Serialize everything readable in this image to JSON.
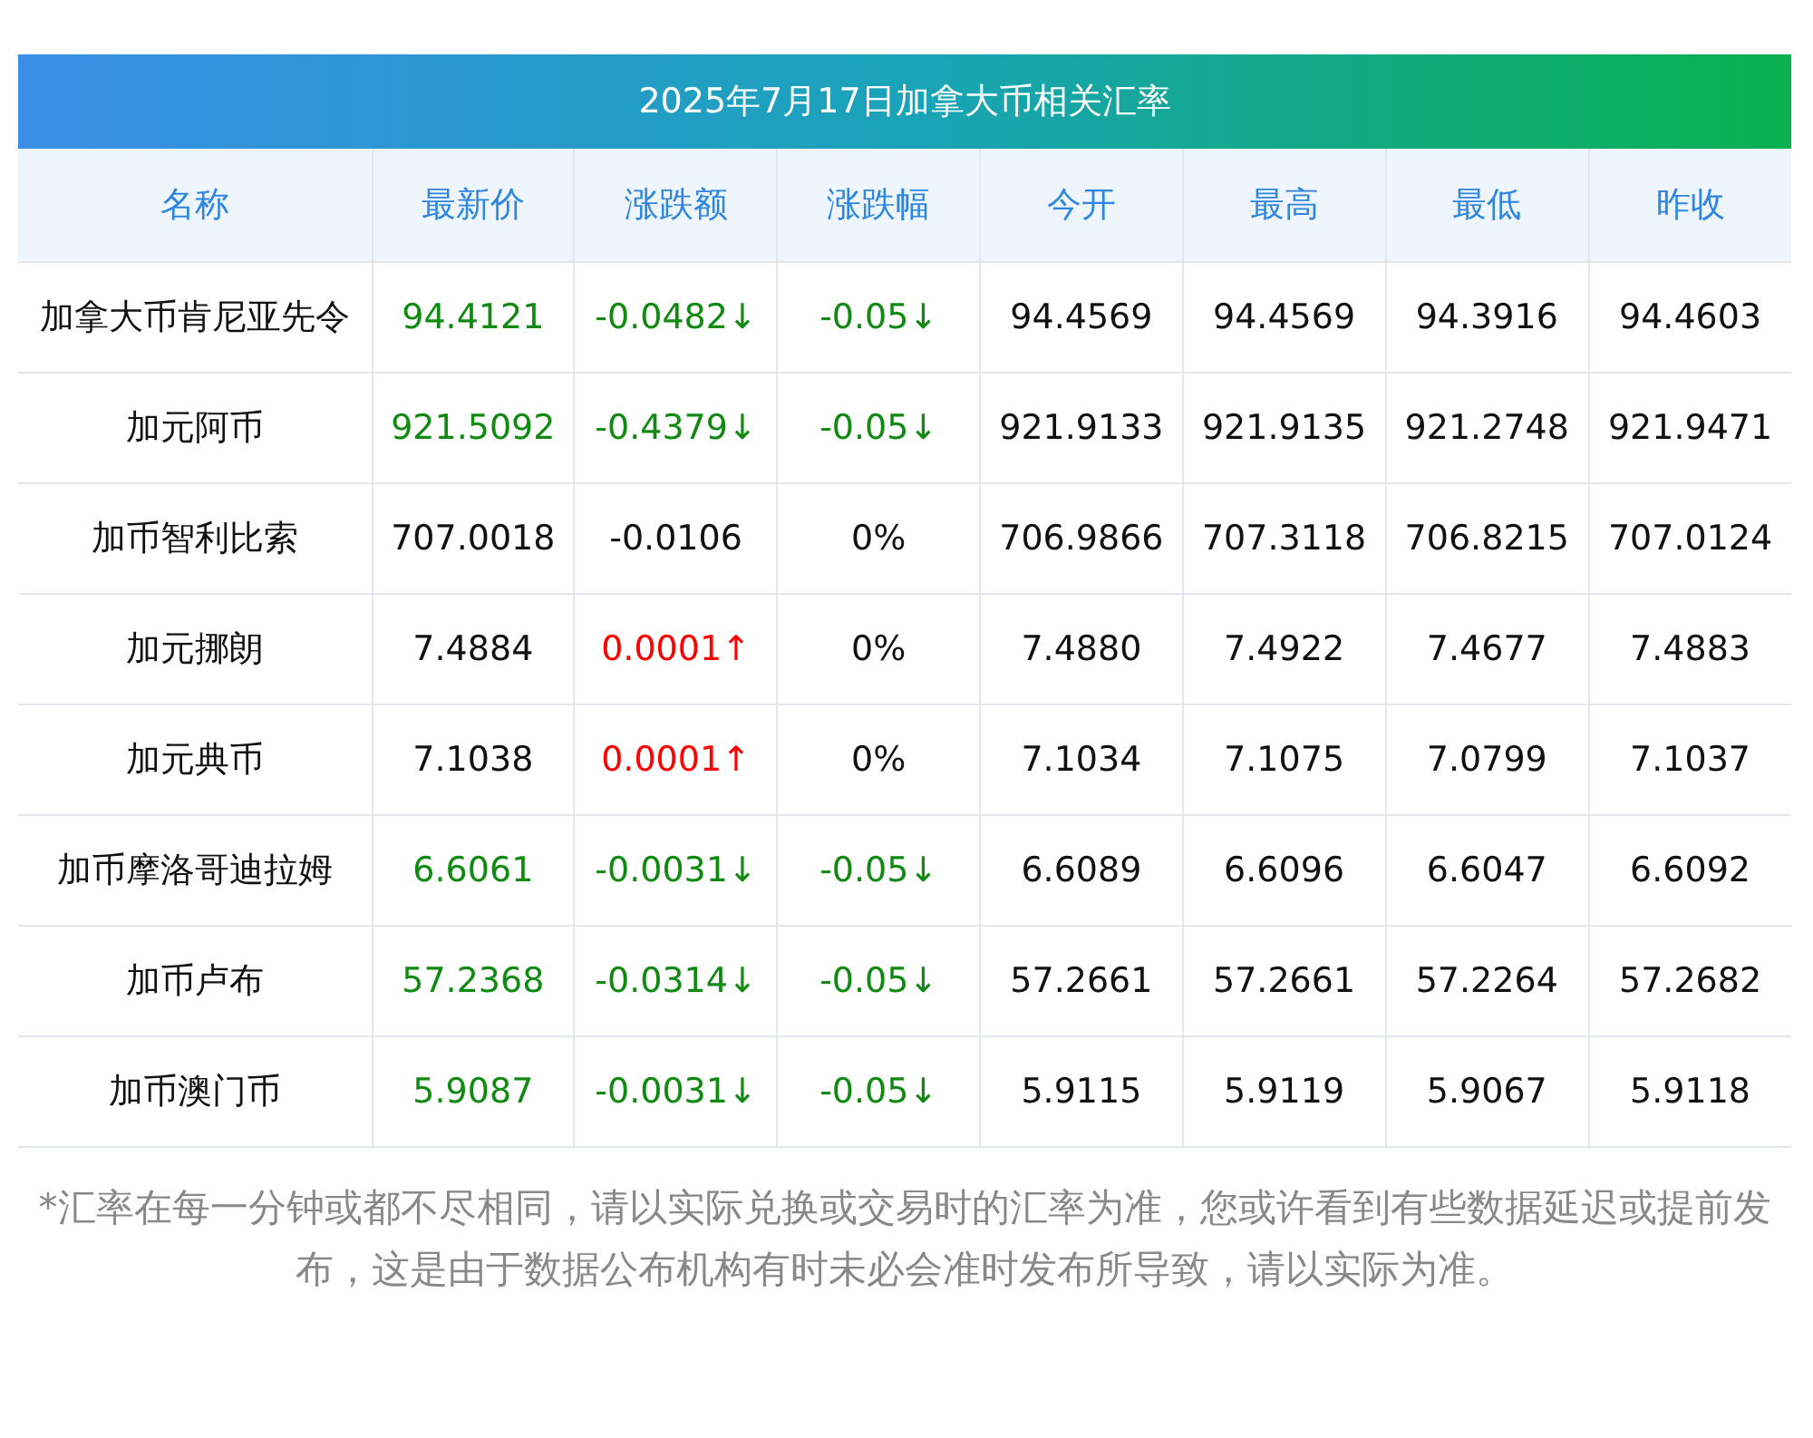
{
  "title": "2025年7月17日加拿大币相关汇率",
  "columns": [
    "名称",
    "最新价",
    "涨跌额",
    "涨跌幅",
    "今开",
    "最高",
    "最低",
    "昨收"
  ],
  "rows": [
    {
      "name": "加拿大币肯尼亚先令",
      "price": {
        "text": "94.4121",
        "color": "#118a11"
      },
      "change": {
        "text": "-0.0482↓",
        "color": "#118a11"
      },
      "pct": {
        "text": "-0.05↓",
        "color": "#118a11"
      },
      "open": "94.4569",
      "high": "94.4569",
      "low": "94.3916",
      "prev": "94.4603"
    },
    {
      "name": "加元阿币",
      "price": {
        "text": "921.5092",
        "color": "#118a11"
      },
      "change": {
        "text": "-0.4379↓",
        "color": "#118a11"
      },
      "pct": {
        "text": "-0.05↓",
        "color": "#118a11"
      },
      "open": "921.9133",
      "high": "921.9135",
      "low": "921.2748",
      "prev": "921.9471"
    },
    {
      "name": "加币智利比索",
      "price": {
        "text": "707.0018",
        "color": "#111111"
      },
      "change": {
        "text": "-0.0106",
        "color": "#111111"
      },
      "pct": {
        "text": "0%",
        "color": "#111111"
      },
      "open": "706.9866",
      "high": "707.3118",
      "low": "706.8215",
      "prev": "707.0124"
    },
    {
      "name": "加元挪朗",
      "price": {
        "text": "7.4884",
        "color": "#111111"
      },
      "change": {
        "text": "0.0001↑",
        "color": "#ff0000"
      },
      "pct": {
        "text": "0%",
        "color": "#111111"
      },
      "open": "7.4880",
      "high": "7.4922",
      "low": "7.4677",
      "prev": "7.4883"
    },
    {
      "name": "加元典币",
      "price": {
        "text": "7.1038",
        "color": "#111111"
      },
      "change": {
        "text": "0.0001↑",
        "color": "#ff0000"
      },
      "pct": {
        "text": "0%",
        "color": "#111111"
      },
      "open": "7.1034",
      "high": "7.1075",
      "low": "7.0799",
      "prev": "7.1037"
    },
    {
      "name": "加币摩洛哥迪拉姆",
      "price": {
        "text": "6.6061",
        "color": "#118a11"
      },
      "change": {
        "text": "-0.0031↓",
        "color": "#118a11"
      },
      "pct": {
        "text": "-0.05↓",
        "color": "#118a11"
      },
      "open": "6.6089",
      "high": "6.6096",
      "low": "6.6047",
      "prev": "6.6092"
    },
    {
      "name": "加币卢布",
      "price": {
        "text": "57.2368",
        "color": "#118a11"
      },
      "change": {
        "text": "-0.0314↓",
        "color": "#118a11"
      },
      "pct": {
        "text": "-0.05↓",
        "color": "#118a11"
      },
      "open": "57.2661",
      "high": "57.2661",
      "low": "57.2264",
      "prev": "57.2682"
    },
    {
      "name": "加币澳门币",
      "price": {
        "text": "5.9087",
        "color": "#118a11"
      },
      "change": {
        "text": "-0.0031↓",
        "color": "#118a11"
      },
      "pct": {
        "text": "-0.05↓",
        "color": "#118a11"
      },
      "open": "5.9115",
      "high": "5.9119",
      "low": "5.9067",
      "prev": "5.9118"
    }
  ],
  "note": "*汇率在每一分钟或都不尽相同，请以实际兑换或交易时的汇率为准，您或许看到有些数据延迟或提前发布，这是由于数据公布机构有时未必会准时发布所导致，请以实际为准。"
}
